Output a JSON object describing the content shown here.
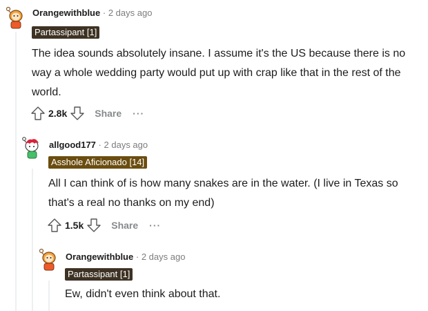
{
  "comments": [
    {
      "user": "Orangewithblue",
      "separator": "·",
      "time": "2 days ago",
      "flair": "Partassipant [1]",
      "flair_color": "#3e3224",
      "text": "The idea sounds absolutely insane. I assume it's the US because there is no way a whole wedding party would put up with crap like that in the rest of the world.",
      "score": "2.8k",
      "share_label": "Share",
      "more_label": "···",
      "avatar_icon": "snoo-orange-avatar-icon"
    },
    {
      "user": "allgood177",
      "separator": "·",
      "time": "2 days ago",
      "flair": "Asshole Aficionado [14]",
      "flair_color": "#6b4d10",
      "text": "All I can think of is how many snakes are in the water. (I live in Texas so that's a real no thanks on my end)",
      "score": "1.5k",
      "share_label": "Share",
      "more_label": "···",
      "avatar_icon": "snoo-red-hair-avatar-icon"
    },
    {
      "user": "Orangewithblue",
      "separator": "·",
      "time": "2 days ago",
      "flair": "Partassipant [1]",
      "flair_color": "#3e3224",
      "text": "Ew, didn't even think about that.",
      "avatar_icon": "snoo-orange-avatar-icon"
    }
  ]
}
